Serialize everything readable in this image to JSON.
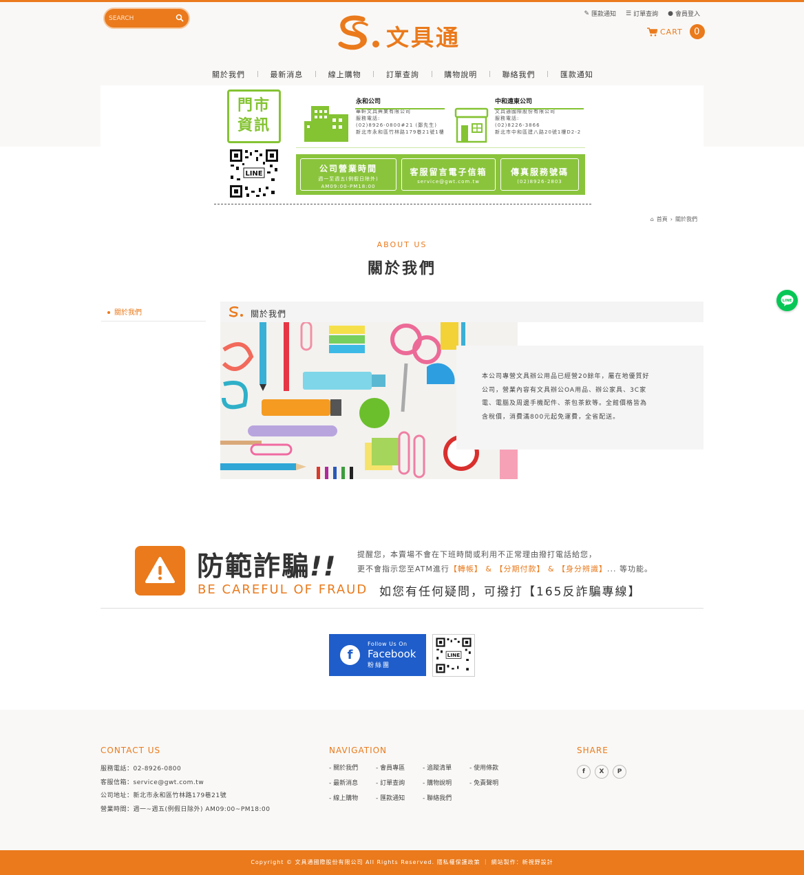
{
  "header": {
    "search_placeholder": "SEARCH",
    "logo_text": "文具通",
    "toplinks": [
      "匯款通知",
      "訂單查詢",
      "會員登入"
    ],
    "cart_label": "CART",
    "cart_count": "0"
  },
  "nav": [
    "關於我們",
    "最新消息",
    "線上購物",
    "訂單查詢",
    "購物說明",
    "聯絡我們",
    "匯款通知"
  ],
  "banner": {
    "store_badge_line1": "門市",
    "store_badge_line2": "資訊",
    "company1": {
      "name": "永和公司",
      "lines": [
        "華軒文具興業有限公司",
        "服務電話:",
        "(02)8926-0800#21 (鄭先生)",
        "新北市永和區竹林路179巷21號1樓"
      ]
    },
    "company2": {
      "name": "中和遠東公司",
      "lines": [
        "文具通國際股份有限公司",
        "服務電話:",
        "(02)8226-3866",
        "新北市中和區建八路20號1樓D2-2"
      ]
    },
    "box1": {
      "title": "公司營業時間",
      "sub1": "週一至週五(例假日除外)",
      "sub2": "AM09:00-PM18:00"
    },
    "box2": {
      "title": "客服留言電子信箱",
      "sub1": "service@gwt.com.tw"
    },
    "box3": {
      "title": "傳真服務號碼",
      "sub1": "(02)8926-2803"
    }
  },
  "breadcrumb": {
    "home": "首頁",
    "separator": "›",
    "current": "關於我們"
  },
  "about": {
    "en": "ABOUT US",
    "zh": "關於我們"
  },
  "sidebar": {
    "item": "關於我們"
  },
  "section": {
    "title": "關於我們"
  },
  "intro": [
    "本公司專營文具辦公用品已經營20餘年，屬在地優質好",
    "公司，營業內容有文具辦公OA用品、辦公家具、3C家",
    "電、電腦及周邊手機配件、茶包茶飲等。全館價格皆為",
    "含稅價，消費滿800元起免運費，全省配送。"
  ],
  "fraud": {
    "title": "防範詐騙",
    "title_mark": "!!",
    "en": "BE CAREFUL OF FRAUD",
    "line1": "提醒您，本賣場不會在下班時間或利用不正常理由撥打電話給您，",
    "line2_a": "更不會指示您至ATM進行",
    "line2_hl": "【轉帳】 & 【分期付款】 & 【身分辨識】",
    "line2_b": "... 等功能。",
    "line3": "如您有任何疑問，可撥打【165反詐騙專線】"
  },
  "facebook": {
    "line1": "Follow Us On",
    "line2": "Facebook",
    "line3": "粉絲團"
  },
  "footer": {
    "contact_title": "CONTACT US",
    "contact": [
      "服務電話：02-8926-0800",
      "客服信箱：service@gwt.com.tw",
      "公司地址：新北市永和區竹林路179巷21號",
      "營業時間：週一~週五(例假日除外) AM09:00~PM18:00"
    ],
    "nav_title": "NAVIGATION",
    "nav_links": [
      "- 關於我們",
      "- 會員專區",
      "- 追蹤清單",
      "- 使用條款",
      "- 最新消息",
      "- 訂單查詢",
      "- 購物說明",
      "- 免責聲明",
      "- 線上購物",
      "- 匯款通知",
      "- 聯絡我們"
    ],
    "share_title": "SHARE",
    "share": [
      "f",
      "X",
      "P"
    ]
  },
  "copyright": "Copyright © 文具通國際股份有限公司 All Rights Reserved. 隱私權保護政策 ｜ 網站製作：新視野設計",
  "colors": {
    "brand": "#ea7a1c",
    "green": "#8ac43c",
    "facebook": "#1e5dca",
    "line": "#06c755"
  }
}
